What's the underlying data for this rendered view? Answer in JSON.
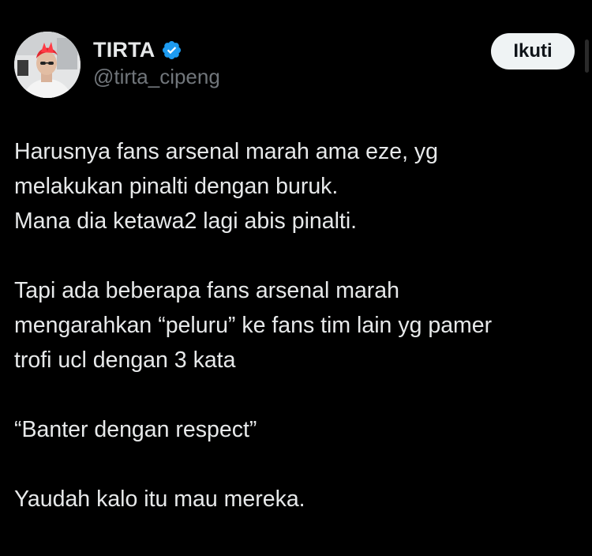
{
  "author": {
    "display_name": "TIRTA",
    "handle": "@tirta_cipeng",
    "verified": true,
    "verified_icon": "verified-badge-icon",
    "verified_color": "#1d9bf0"
  },
  "follow_button": {
    "label": "Ikuti"
  },
  "tweet": {
    "paragraphs": [
      {
        "lines": [
          "Harusnya fans arsenal marah ama eze, yg",
          "melakukan pinalti dengan buruk.",
          "Mana dia ketawa2 lagi abis pinalti."
        ]
      },
      {
        "lines": [
          "Tapi ada beberapa fans arsenal marah",
          "mengarahkan “peluru” ke fans tim lain yg pamer",
          "trofi ucl dengan 3 kata"
        ]
      },
      {
        "lines": [
          "“Banter dengan respect”"
        ]
      },
      {
        "lines": [
          "Yaudah kalo itu mau mereka."
        ]
      }
    ]
  },
  "colors": {
    "background": "#000000",
    "text_primary": "#e7e9ea",
    "text_secondary": "#71767b",
    "button_bg": "#eff3f4",
    "button_text": "#0f1419"
  }
}
